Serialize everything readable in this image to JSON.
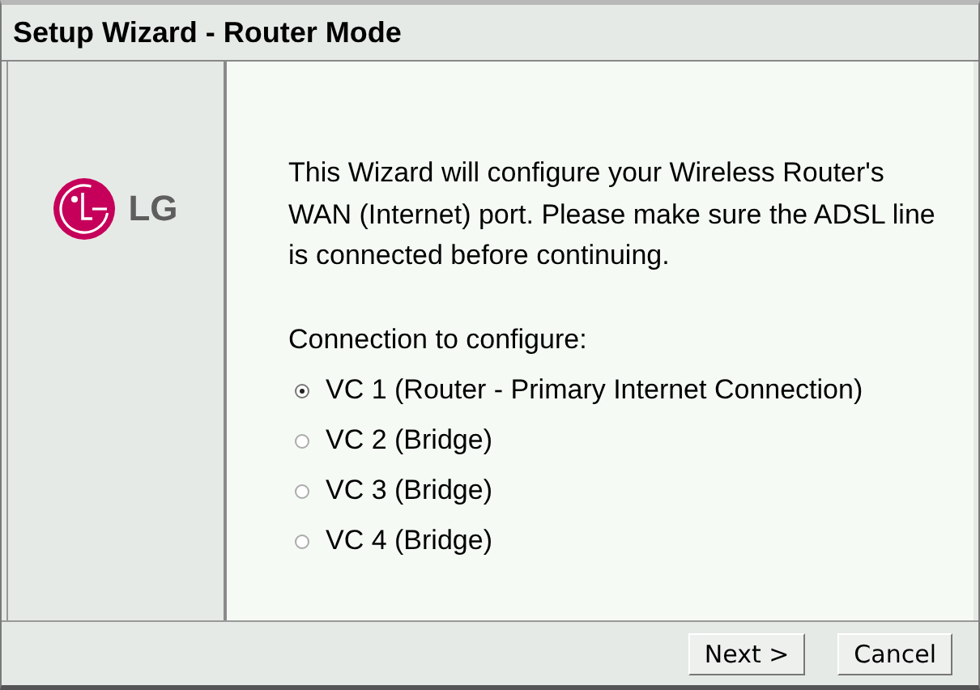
{
  "window": {
    "title": "Setup Wizard - Router Mode"
  },
  "logo": {
    "text": "LG"
  },
  "intro": "This Wizard will configure your Wireless Router's WAN (Internet) port. Please make sure the ADSL line is connected before continuing.",
  "connection_label": "Connection to configure:",
  "connections": [
    {
      "label": "VC 1 (Router - Primary Internet Connection)",
      "selected": true
    },
    {
      "label": "VC 2 (Bridge)",
      "selected": false
    },
    {
      "label": "VC 3 (Bridge)",
      "selected": false
    },
    {
      "label": "VC 4 (Bridge)",
      "selected": false
    }
  ],
  "buttons": [
    "Next >",
    "Cancel"
  ]
}
